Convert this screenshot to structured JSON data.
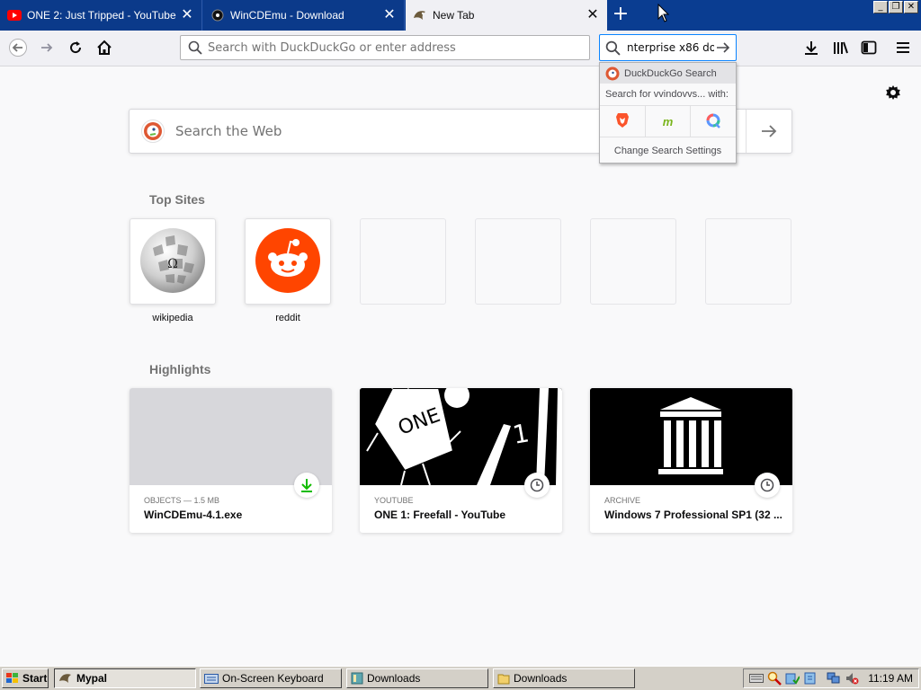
{
  "tabs": [
    {
      "title": "ONE 2: Just Tripped - YouTube",
      "icon": "youtube-icon"
    },
    {
      "title": "WinCDEmu - Download",
      "icon": "wincdemu-icon"
    },
    {
      "title": "New Tab",
      "icon": "mypal-icon"
    }
  ],
  "toolbar": {
    "url_placeholder": "Search with DuckDuckGo or enter address",
    "search_value": "nterprise x86 do"
  },
  "search_popup": {
    "engine": "DuckDuckGo Search",
    "search_for": "Search for vvindovvs... with:",
    "change_settings": "Change Search Settings",
    "engines": [
      "brave-icon",
      "mojeek-icon",
      "qwant-icon"
    ]
  },
  "page": {
    "web_search_placeholder": "Search the Web",
    "top_sites_title": "Top Sites",
    "top_sites": [
      {
        "label": "wikipedia",
        "icon": "wikipedia-icon"
      },
      {
        "label": "reddit",
        "icon": "reddit-icon"
      }
    ],
    "highlights_title": "Highlights",
    "highlights": [
      {
        "context": "OBJECTS — 1.5 MB",
        "title": "WinCDEmu-4.1.exe",
        "badge": "download-icon"
      },
      {
        "context": "YOUTUBE",
        "title": "ONE 1: Freefall - YouTube",
        "badge": "clock-icon"
      },
      {
        "context": "ARCHIVE",
        "title": "Windows 7 Professional SP1 (32 ...",
        "badge": "clock-icon"
      }
    ]
  },
  "taskbar": {
    "start_label": "Start",
    "buttons": [
      {
        "label": "Mypal",
        "active": true
      },
      {
        "label": "On-Screen Keyboard"
      },
      {
        "label": "Downloads"
      },
      {
        "label": "Downloads"
      }
    ],
    "clock": "11:19 AM"
  },
  "colors": {
    "tabstrip": "#0a3d91",
    "accent": "#0a84ff",
    "reddit": "#ff4500",
    "duckduckgo": "#de5833"
  }
}
